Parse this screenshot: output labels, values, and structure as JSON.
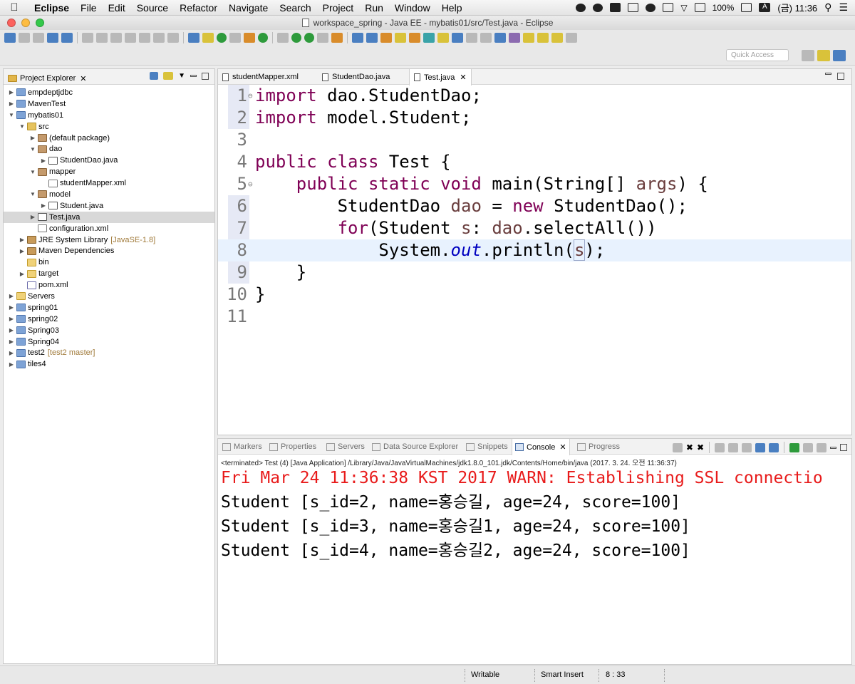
{
  "menubar": {
    "app": "Eclipse",
    "items": [
      "File",
      "Edit",
      "Source",
      "Refactor",
      "Navigate",
      "Search",
      "Project",
      "Run",
      "Window",
      "Help"
    ],
    "battery": "100%",
    "input_source": "A",
    "clock": "(금) 11:36"
  },
  "window": {
    "title": "workspace_spring - Java EE - mybatis01/src/Test.java - Eclipse"
  },
  "toolbar": {
    "quick_access_placeholder": "Quick Access"
  },
  "explorer": {
    "tab_label": "Project Explorer",
    "items": [
      {
        "label": "empdeptjdbc",
        "depth": 0,
        "arrow": "▶",
        "icon": "project",
        "deco": ""
      },
      {
        "label": "MavenTest",
        "depth": 0,
        "arrow": "▶",
        "icon": "project",
        "deco": ""
      },
      {
        "label": "mybatis01",
        "depth": 0,
        "arrow": "▼",
        "icon": "project",
        "deco": ""
      },
      {
        "label": "src",
        "depth": 1,
        "arrow": "▼",
        "icon": "srcf",
        "deco": ""
      },
      {
        "label": "(default package)",
        "depth": 2,
        "arrow": "▶",
        "icon": "pkg",
        "deco": ""
      },
      {
        "label": "dao",
        "depth": 2,
        "arrow": "▼",
        "icon": "pkg",
        "deco": ""
      },
      {
        "label": "StudentDao.java",
        "depth": 3,
        "arrow": "▶",
        "icon": "java",
        "deco": ""
      },
      {
        "label": "mapper",
        "depth": 2,
        "arrow": "▼",
        "icon": "pkg",
        "deco": ""
      },
      {
        "label": "studentMapper.xml",
        "depth": 3,
        "arrow": "",
        "icon": "xml",
        "deco": ""
      },
      {
        "label": "model",
        "depth": 2,
        "arrow": "▼",
        "icon": "pkg",
        "deco": ""
      },
      {
        "label": "Student.java",
        "depth": 3,
        "arrow": "▶",
        "icon": "java",
        "deco": ""
      },
      {
        "label": "Test.java",
        "depth": 2,
        "arrow": "▶",
        "icon": "java",
        "deco": "",
        "selected": true
      },
      {
        "label": "configuration.xml",
        "depth": 2,
        "arrow": "",
        "icon": "xml",
        "deco": ""
      },
      {
        "label": "JRE System Library",
        "depth": 1,
        "arrow": "▶",
        "icon": "lib",
        "deco": "[JavaSE-1.8]"
      },
      {
        "label": "Maven Dependencies",
        "depth": 1,
        "arrow": "▶",
        "icon": "lib",
        "deco": ""
      },
      {
        "label": "bin",
        "depth": 1,
        "arrow": "",
        "icon": "fold",
        "deco": ""
      },
      {
        "label": "target",
        "depth": 1,
        "arrow": "▶",
        "icon": "fold",
        "deco": ""
      },
      {
        "label": "pom.xml",
        "depth": 1,
        "arrow": "",
        "icon": "mfile",
        "deco": ""
      },
      {
        "label": "Servers",
        "depth": 0,
        "arrow": "▶",
        "icon": "fold",
        "deco": ""
      },
      {
        "label": "spring01",
        "depth": 0,
        "arrow": "▶",
        "icon": "project",
        "deco": ""
      },
      {
        "label": "spring02",
        "depth": 0,
        "arrow": "▶",
        "icon": "project",
        "deco": ""
      },
      {
        "label": "Spring03",
        "depth": 0,
        "arrow": "▶",
        "icon": "project",
        "deco": ""
      },
      {
        "label": "Spring04",
        "depth": 0,
        "arrow": "▶",
        "icon": "project",
        "deco": ""
      },
      {
        "label": "test2",
        "depth": 0,
        "arrow": "▶",
        "icon": "project",
        "deco": "[test2 master]"
      },
      {
        "label": "tiles4",
        "depth": 0,
        "arrow": "▶",
        "icon": "project",
        "deco": ""
      }
    ]
  },
  "editor": {
    "tabs": [
      "studentMapper.xml",
      "StudentDao.java",
      "Test.java"
    ],
    "active_tab": "Test.java",
    "line_numbers": [
      "1",
      "2",
      "3",
      "4",
      "5",
      "6",
      "7",
      "8",
      "9",
      "10",
      "11"
    ]
  },
  "console": {
    "tabs": [
      "Markers",
      "Properties",
      "Servers",
      "Data Source Explorer",
      "Snippets",
      "Console",
      "Progress"
    ],
    "active_tab": "Console",
    "terminated": "<terminated> Test (4) [Java Application] /Library/Java/JavaVirtualMachines/jdk1.8.0_101.jdk/Contents/Home/bin/java (2017. 3. 24. 오전 11:36:37)",
    "lines": [
      "Fri Mar 24 11:36:38 KST 2017 WARN: Establishing SSL connectio",
      "Student [s_id=2, name=홍승길, age=24, score=100]",
      "Student [s_id=3, name=홍승길1, age=24, score=100]",
      "Student [s_id=4, name=홍승길2, age=24, score=100]"
    ]
  },
  "statusbar": {
    "writable": "Writable",
    "insert_mode": "Smart Insert",
    "position": "8 : 33"
  },
  "colors": {
    "keyword": "#7f0055",
    "field": "#0000c0",
    "variable": "#6a3e3e",
    "console_error": "#e81b1b",
    "current_line": "#e8f2fe"
  }
}
